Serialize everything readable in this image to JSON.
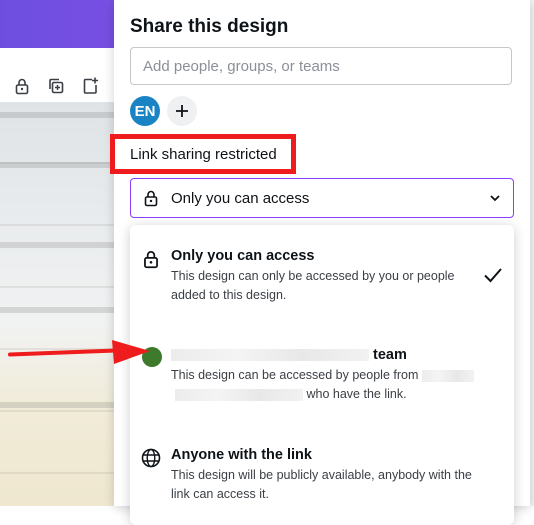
{
  "colors": {
    "brand_gradient": "#7d4fe3",
    "focus_border": "#8b3dff",
    "avatar_bg": "#1a83c4",
    "annotation_red": "#ee1c1c",
    "team_avatar": "#3d7a2c"
  },
  "toolbar": {
    "icons": [
      "lock-icon",
      "duplicate-icon",
      "add-page-icon"
    ]
  },
  "share_panel": {
    "title": "Share this design",
    "people_input_placeholder": "Add people, groups, or teams",
    "avatar_initials": "EN",
    "add_person_icon": "plus-icon",
    "link_sharing_label": "Link sharing restricted",
    "access_select": {
      "icon": "lock-icon",
      "value": "Only you can access",
      "chevron": "chevron-down-icon"
    },
    "options": [
      {
        "icon": "lock-icon",
        "title": "Only you can access",
        "description": "This design can only be accessed by you or people added to this design.",
        "selected": true
      },
      {
        "icon": "team-avatar",
        "title_suffix": "team",
        "description_start": "This design can be accessed by people from",
        "description_end": "who have the link.",
        "selected": false
      },
      {
        "icon": "globe-icon",
        "title": "Anyone with the link",
        "description": "This design will be publicly available, anybody with the link can access it.",
        "selected": false
      }
    ]
  }
}
